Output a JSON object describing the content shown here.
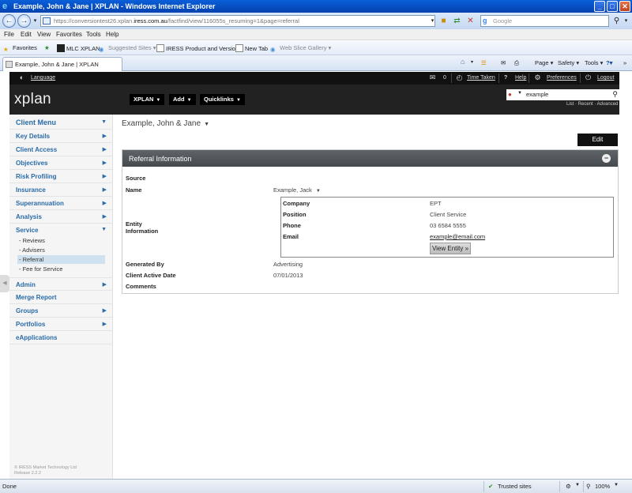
{
  "window": {
    "title": "Example, John & Jane | XPLAN - Windows Internet Explorer",
    "url_prefix": "https://conversiontest26.xplan.",
    "url_domain": "iress.com.au",
    "url_path": "/factfind/view/116055s_resuming=1&page=referral",
    "search_placeholder": "Google"
  },
  "menubar": [
    "File",
    "Edit",
    "View",
    "Favorites",
    "Tools",
    "Help"
  ],
  "favorites": {
    "label": "Favorites",
    "items": [
      "MLC XPLAN",
      "Suggested Sites ▾",
      "IRESS Product and Versions",
      "New Tab",
      "Web Slice Gallery ▾"
    ]
  },
  "tab": {
    "title": "Example, John & Jane | XPLAN"
  },
  "commandbar": [
    "Page ▾",
    "Safety ▾",
    "Tools ▾"
  ],
  "xplan": {
    "top": {
      "language": "Language",
      "mail_count": "0",
      "time_taken": "Time Taken",
      "help_symbol": "?",
      "help": "Help",
      "preferences": "Preferences",
      "logout": "Logout"
    },
    "logo": "xplan",
    "menus": [
      "XPLAN",
      "Add",
      "Quicklinks"
    ],
    "search_value": "example",
    "search_links": "List · Recent · Advanced"
  },
  "sidebar": {
    "header": "Client Menu",
    "items_top": [
      "Key Details",
      "Client Access",
      "Objectives",
      "Risk Profiling",
      "Insurance",
      "Superannuation",
      "Analysis"
    ],
    "service": "Service",
    "service_sub": [
      "- Reviews",
      "- Advisers",
      "- Referral",
      "- Fee for Service"
    ],
    "items_bottom": [
      {
        "label": "Admin",
        "arrow": true
      },
      {
        "label": "Merge Report",
        "arrow": false
      },
      {
        "label": "Groups",
        "arrow": true
      },
      {
        "label": "Portfolios",
        "arrow": true
      },
      {
        "label": "eApplications",
        "arrow": false
      }
    ],
    "footer_line1": "© IRESS Market Technology Ltd",
    "footer_line2": "Release 2.2.2"
  },
  "main": {
    "client_name": "Example, John & Jane",
    "edit_label": "Edit",
    "panel_title": "Referral Information",
    "fields": {
      "source_label": "Source",
      "name_label": "Name",
      "name_value": "Example, Jack",
      "entity_label_line1": "Entity",
      "entity_label_line2": "Information",
      "generated_by_label": "Generated By",
      "generated_by_value": "Advertising",
      "client_active_date_label": "Client Active Date",
      "client_active_date_value": "07/01/2013",
      "comments_label": "Comments"
    },
    "entity": {
      "company_label": "Company",
      "company_value": "EPT",
      "position_label": "Position",
      "position_value": "Client Service",
      "phone_label": "Phone",
      "phone_value": "03 6584 5555",
      "email_label": "Email",
      "email_value": "example@email.com",
      "view_entity_label": "View Entity »"
    }
  },
  "statusbar": {
    "left": "Done",
    "zone": "Trusted sites",
    "zoom": "100%"
  }
}
